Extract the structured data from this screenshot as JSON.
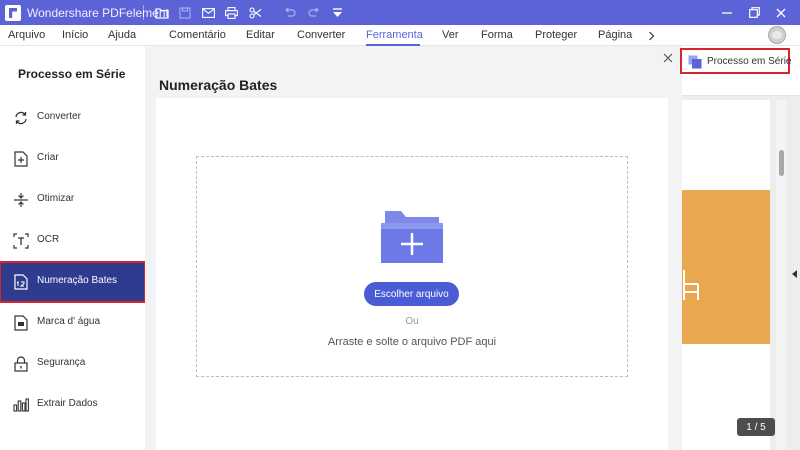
{
  "app": {
    "title": "Wondershare PDFelement"
  },
  "colors": {
    "brand": "#5b63d6",
    "active_sidebar": "#2e3b8f",
    "highlight": "#d9232d",
    "button": "#4a5bd6",
    "doc_image": "#e9a84f"
  },
  "toolbar": {
    "icons": [
      "open-folder-icon",
      "save-icon",
      "email-icon",
      "print-icon",
      "scissors-icon",
      "undo-icon",
      "redo-icon",
      "quick-access-dropdown-icon"
    ]
  },
  "window_controls": {
    "icons": [
      "minimize-icon",
      "restore-icon",
      "close-icon"
    ]
  },
  "menu": {
    "left": [
      "Arquivo",
      "Início",
      "Ajuda"
    ],
    "tabs": [
      "Comentário",
      "Editar",
      "Converter",
      "Ferramenta",
      "Ver",
      "Forma",
      "Proteger",
      "Página"
    ],
    "active_tab": "Ferramenta",
    "more_icon": "chevron-right-icon"
  },
  "sidebar": {
    "title": "Processo em Série",
    "items": [
      {
        "label": "Converter",
        "icon": "convert-icon",
        "active": false
      },
      {
        "label": "Criar",
        "icon": "create-icon",
        "active": false
      },
      {
        "label": "Otimizar",
        "icon": "optimize-icon",
        "active": false
      },
      {
        "label": "OCR",
        "icon": "ocr-icon",
        "active": false
      },
      {
        "label": "Numeração Bates",
        "icon": "bates-numbering-icon",
        "active": true
      },
      {
        "label": "Marca d' água",
        "icon": "watermark-icon",
        "active": false
      },
      {
        "label": "Segurança",
        "icon": "security-icon",
        "active": false
      },
      {
        "label": "Extrair Dados",
        "icon": "extract-data-icon",
        "active": false
      }
    ]
  },
  "main": {
    "title": "Numeração Bates",
    "choose_button": "Escolher arquivo",
    "or_text": "Ou",
    "drag_text": "Arraste e solte o arquivo PDF aqui"
  },
  "right_panel": {
    "batch_button": "Processo em Série",
    "page_indicator": "1 / 5"
  }
}
